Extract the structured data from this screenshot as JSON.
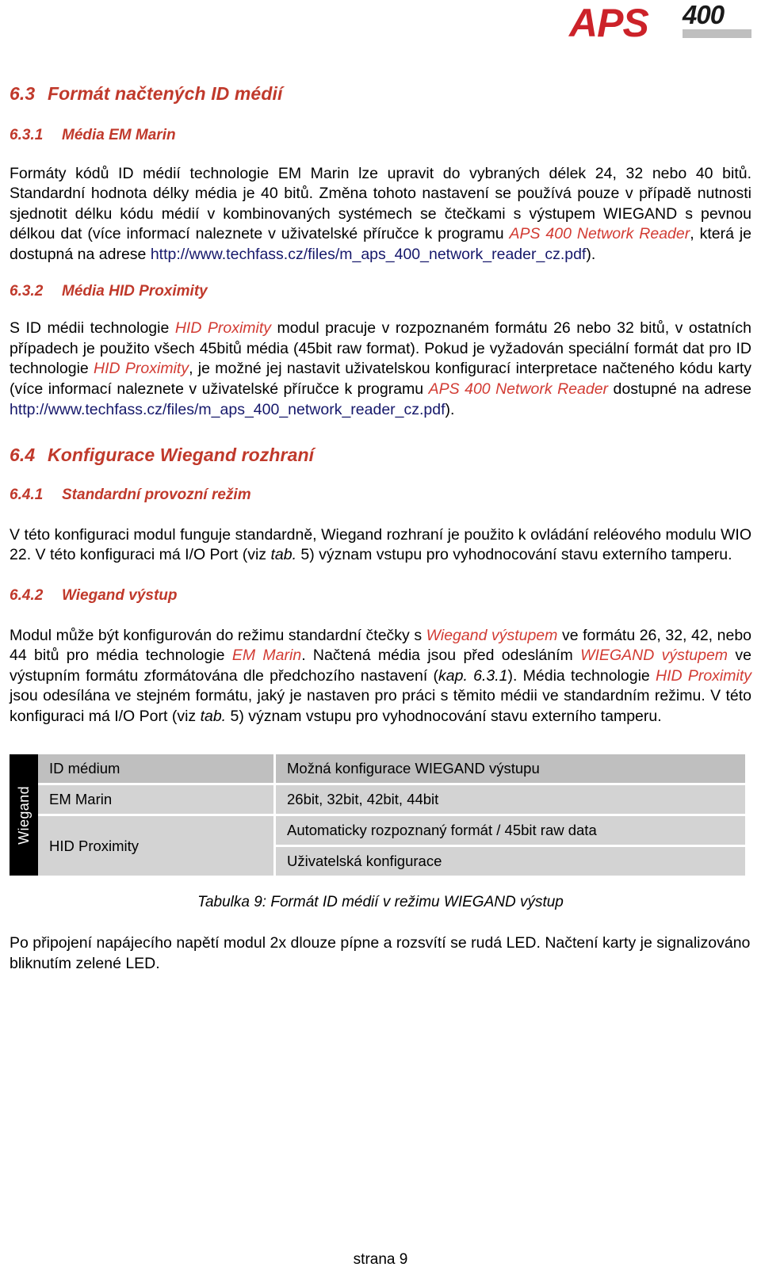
{
  "logo": {
    "brand": "APS",
    "model": "400"
  },
  "headings": {
    "s63_num": "6.3",
    "s63_title": "Formát načtených ID médií",
    "s631_num": "6.3.1",
    "s631_title": "Média EM Marin",
    "s632_num": "6.3.2",
    "s632_title": "Média HID Proximity",
    "s64_num": "6.4",
    "s64_title": "Konfigurace Wiegand rozhraní",
    "s641_num": "6.4.1",
    "s641_title": "Standardní provozní režim",
    "s642_num": "6.4.2",
    "s642_title": "Wiegand výstup"
  },
  "paragraphs": {
    "p631_a": "Formáty kódů ID médií technologie EM Marin lze upravit do vybraných délek 24, 32 nebo 40 bitů. Standardní hodnota délky média je 40 bitů. Změna tohoto nastavení se používá pouze v případě nutnosti sjednotit délku kódu médií v kombinovaných systémech se čtečkami s výstupem WIEGAND s pevnou délkou dat (více informací naleznete v uživatelské příručce k programu ",
    "p631_link_label": "APS 400 Network Reader",
    "p631_b": ", která je dostupná na adrese ",
    "p631_url": "http://www.techfass.cz/files/m_aps_400_network_reader_cz.pdf",
    "p631_c": ").",
    "p632_a": "S ID médii technologie ",
    "p632_hid1": "HID Proximity",
    "p632_b": " modul pracuje v rozpoznaném formátu 26 nebo 32 bitů, v ostatních případech je použito všech 45bitů média (45bit raw format). Pokud je vyžadován speciální formát dat pro ID technologie ",
    "p632_hid2": "HID Proximity",
    "p632_c": ", je možné jej nastavit uživatelskou konfigurací interpretace načteného kódu karty (více informací naleznete v uživatelské příručce k programu ",
    "p632_link_label": "APS 400 Network Reader",
    "p632_d": " dostupné na adrese ",
    "p632_url": "http://www.techfass.cz/files/m_aps_400_network_reader_cz.pdf",
    "p632_e": ").",
    "p641_a": "V této konfiguraci modul funguje standardně, Wiegand rozhraní je použito k ovládání reléového modulu WIO 22. V této konfiguraci má I/O Port (viz ",
    "p641_tab": "tab.",
    "p641_b": " 5) význam vstupu pro vyhodnocování stavu externího tamperu.",
    "p642_a": "Modul může být konfigurován do režimu standardní čtečky s ",
    "p642_r1": "Wiegand výstupem",
    "p642_b": " ve formátu 26, 32, 42, nebo 44 bitů pro média technologie ",
    "p642_r2": "EM Marin",
    "p642_c": ". Načtená média jsou před odesláním ",
    "p642_r3": "WIEGAND výstupem",
    "p642_d": " ve výstupním formátu zformátována dle předchozího nastavení (",
    "p642_kap": "kap. 6.3.1",
    "p642_e": "). Média technologie ",
    "p642_r4": "HID Proximity",
    "p642_f": " jsou odesílána ve stejném formátu, jaký je nastaven pro práci s těmito médii ve standardním režimu. V této konfiguraci má I/O Port (viz ",
    "p642_tab": "tab.",
    "p642_g": " 5) význam vstupu pro vyhodnocování stavu externího tamperu.",
    "p_tail": "Po připojení napájecího napětí modul 2x dlouze pípne a rozsvítí se rudá LED. Načtení karty je signalizováno bliknutím zelené LED."
  },
  "table": {
    "side_label": "Wiegand",
    "headers": [
      "ID médium",
      "Možná konfigurace WIEGAND výstupu"
    ],
    "rows": [
      {
        "medium": "EM Marin",
        "configs": [
          "26bit, 32bit, 42bit, 44bit"
        ]
      },
      {
        "medium": "HID Proximity",
        "configs": [
          "Automaticky rozpoznaný formát / 45bit raw data",
          "Uživatelská konfigurace"
        ]
      }
    ],
    "caption": "Tabulka 9: Formát ID médií v režimu WIEGAND výstup"
  },
  "footer": {
    "page_label": "strana 9"
  },
  "colors": {
    "heading_red": "#c0392b",
    "inline_red": "#d23b33",
    "url_blue": "#16186b",
    "logo_red": "#cc2229",
    "logo_gray": "#bfbfbf",
    "table_header_gray": "#bfbfbf",
    "table_cell_gray": "#d3d3d3",
    "table_side_black": "#000000"
  }
}
